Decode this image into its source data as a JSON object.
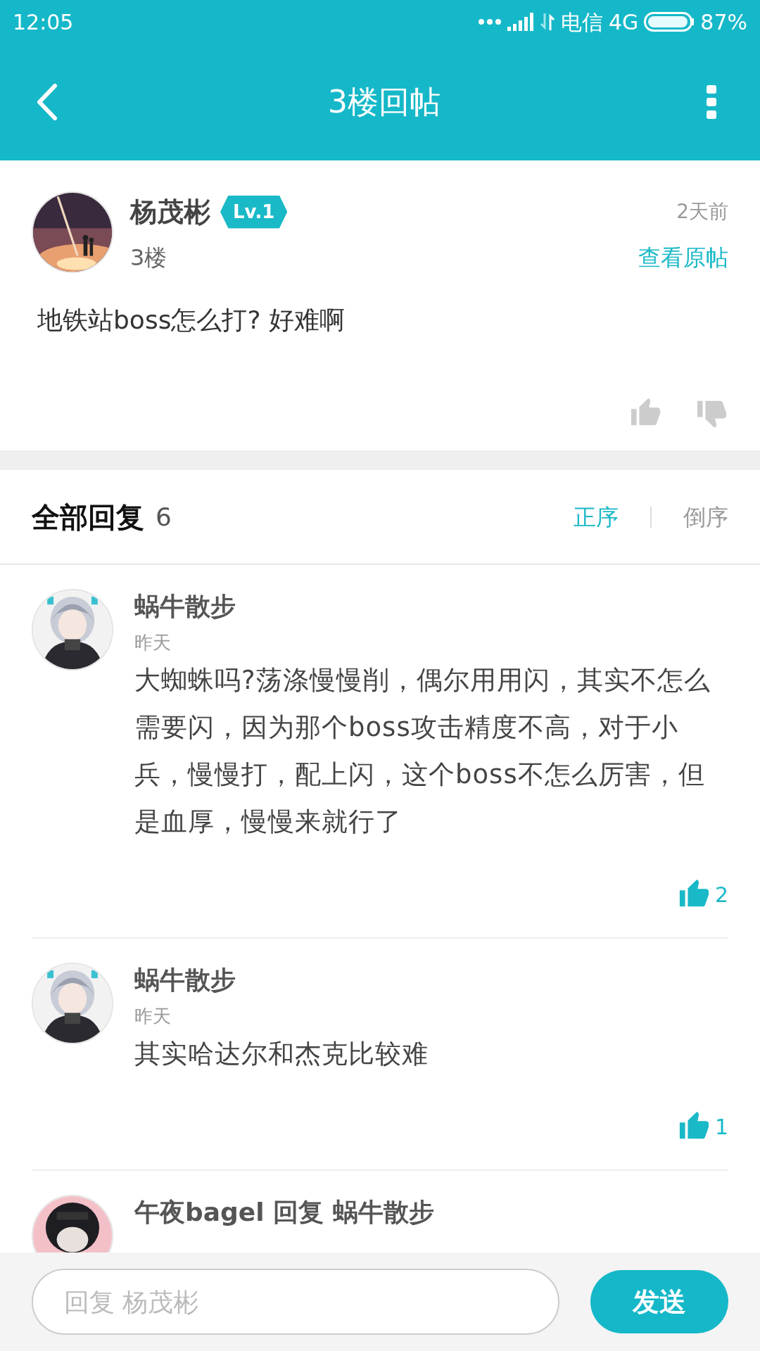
{
  "status_bar": {
    "time": "12:05",
    "carrier": "电信",
    "network": "4G",
    "battery": "87%"
  },
  "header": {
    "title": "3楼回帖"
  },
  "post": {
    "author": "杨茂彬",
    "level_badge": "Lv.1",
    "floor": "3楼",
    "time": "2天前",
    "view_original": "查看原帖",
    "text": "地铁站boss怎么打? 好难啊"
  },
  "replies_header": {
    "title": "全部回复",
    "count": "6",
    "sort_options": [
      {
        "label": "正序",
        "selected": true
      },
      {
        "label": "倒序",
        "selected": false
      }
    ]
  },
  "replies": [
    {
      "author": "蜗牛散步",
      "time": "昨天",
      "text": "大蜘蛛吗?荡涤慢慢削，偶尔用用闪，其实不怎么需要闪，因为那个boss攻击精度不高，对于小兵，慢慢打，配上闪，这个boss不怎么厉害，但是血厚，慢慢来就行了",
      "likes": "2"
    },
    {
      "author": "蜗牛散步",
      "time": "昨天",
      "text": "其实哈达尔和杰克比较难",
      "likes": "1"
    },
    {
      "author": "午夜bagel 回复 蜗牛散步"
    }
  ],
  "reply_bar": {
    "placeholder": "回复 杨茂彬",
    "send_button": "发送"
  }
}
